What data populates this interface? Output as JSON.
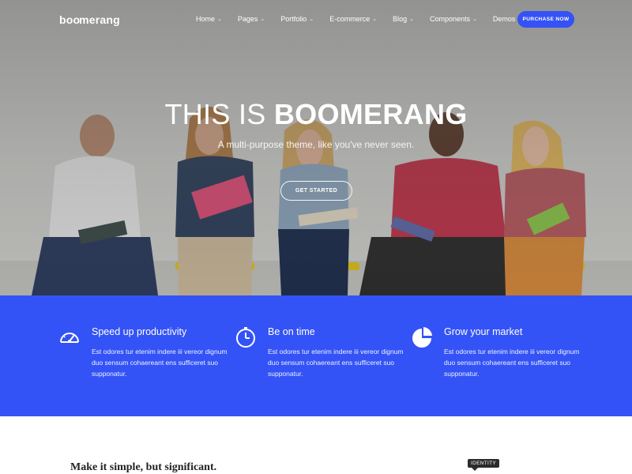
{
  "brand": {
    "logo_pre": "bo",
    "logo_mid": "o",
    "logo_post": "merang"
  },
  "nav": {
    "items": [
      {
        "label": "Home",
        "dropdown": true
      },
      {
        "label": "Pages",
        "dropdown": true
      },
      {
        "label": "Portfolio",
        "dropdown": true
      },
      {
        "label": "E-commerce",
        "dropdown": true
      },
      {
        "label": "Blog",
        "dropdown": true
      },
      {
        "label": "Components",
        "dropdown": true
      },
      {
        "label": "Demos",
        "dropdown": false
      }
    ],
    "purchase_label": "PURCHASE NOW"
  },
  "hero": {
    "title_light": "THIS IS ",
    "title_bold": "BOOMERANG",
    "subtitle": "A multi-purpose theme, like you've never seen.",
    "cta_label": "GET STARTED"
  },
  "features": [
    {
      "icon": "speedometer-icon",
      "title": "Speed up productivity",
      "text": "Est odores tur etenim indere iii vereor dignum duo sensum cohaereant ens sufficeret suo supponatur."
    },
    {
      "icon": "clock-icon",
      "title": "Be on time",
      "text": "Est odores tur etenim indere iii vereor dignum duo sensum cohaereant ens sufficeret suo supponatur."
    },
    {
      "icon": "pie-chart-icon",
      "title": "Grow your market",
      "text": "Est odores tur etenim indere iii vereor dignum duo sensum cohaereant ens sufficeret suo supponatur."
    }
  ],
  "section": {
    "tagline": "Make it simple, but significant.",
    "tooltip": "IDENTITY"
  },
  "colors": {
    "accent": "#3453f6",
    "button": "#3452f5",
    "text": "#222222"
  }
}
